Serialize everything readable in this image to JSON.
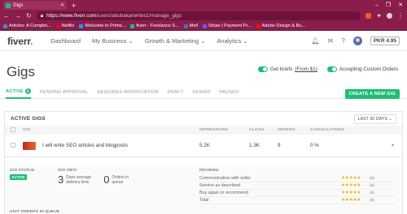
{
  "browser": {
    "tab_title": "Gigs",
    "new_tab": "+",
    "window_controls": [
      "–",
      "❐",
      "✕"
    ],
    "url_host": "https://www.fiverr.com",
    "url_path": "/users/abubakarwrites1/manage_gigs",
    "bookmarks": [
      {
        "label": "Articles: A Complet...",
        "color": "#3b8ad9"
      },
      {
        "label": "Netflix",
        "color": "#e50914"
      },
      {
        "label": "Welcome to Prime...",
        "color": "#1a98ff"
      },
      {
        "label": "fiverr - Freelance S...",
        "color": "#1dbf73"
      },
      {
        "label": "Mwf",
        "color": "#4a6fb5"
      },
      {
        "label": "Stripe | Payment Pr...",
        "color": "#635bff"
      },
      {
        "label": "Adobe Design & Bu...",
        "color": "#fa0f00"
      }
    ]
  },
  "header": {
    "logo": "fiverr",
    "logo_dot": ".",
    "nav": [
      {
        "label": "Dashboard"
      },
      {
        "label": "My Business",
        "chevron": "⌄"
      },
      {
        "label": "Growth & Marketing",
        "chevron": "⌄"
      },
      {
        "label": "Analytics",
        "chevron": "⌄"
      }
    ],
    "balance": "PKR 4.95"
  },
  "page": {
    "title": "Gigs",
    "toggle_briefs": "Get briefs",
    "toggle_briefs_link": "(From $1)",
    "toggle_custom": "Accepting Custom Orders",
    "tabs": [
      {
        "label": "ACTIVE",
        "badge": "1"
      },
      {
        "label": "PENDING APPROVAL"
      },
      {
        "label": "REQUIRES MODIFICATION"
      },
      {
        "label": "DRAFT"
      },
      {
        "label": "DENIED"
      },
      {
        "label": "PAUSED"
      }
    ],
    "create_button": "CREATE A NEW GIG"
  },
  "table": {
    "heading": "ACTIVE GIGS",
    "period": "LAST 30 DAYS ⌄",
    "columns": [
      "GIG",
      "IMPRESSIONS",
      "CLICKS",
      "ORDERS",
      "CANCELLATIONS"
    ],
    "rows": [
      {
        "title": "I will write SEO articles and blogposts",
        "impressions": "5.2K",
        "clicks": "1.3K",
        "orders": "9",
        "cancellations": "0 %"
      }
    ]
  },
  "details": {
    "status_label": "GIG STATUS",
    "status_value": "ACTIVE",
    "info_label": "GIG INFO",
    "delivery_num": "3",
    "delivery_text": "Days average delivery time",
    "queue_num": "0",
    "queue_text": "Orders in queue",
    "reviews_label": "REVIEWS",
    "reviews": [
      {
        "label": "Communication with seller",
        "count": "(5)"
      },
      {
        "label": "Service as described",
        "count": "(5)"
      },
      {
        "label": "Buy again or recommend",
        "count": "(5)"
      },
      {
        "label": "Total",
        "count": "(5)"
      }
    ],
    "units_label": "UNIT ORDERS IN QUEUE"
  }
}
